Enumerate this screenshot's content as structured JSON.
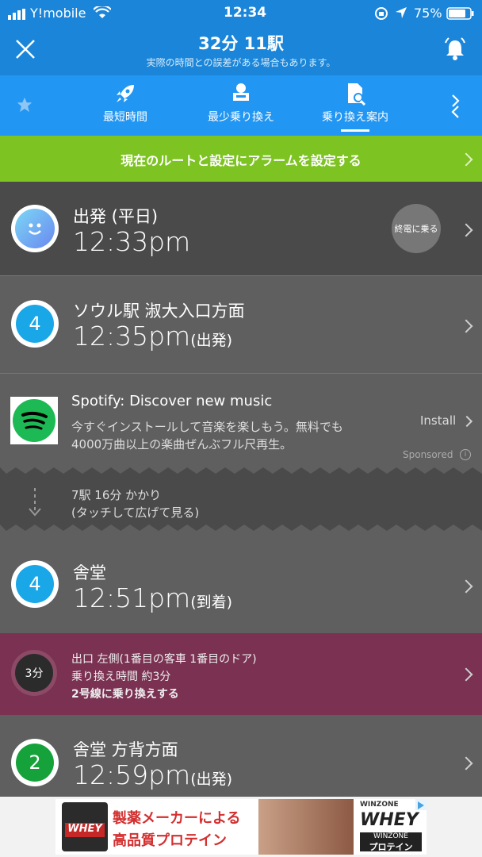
{
  "status_bar": {
    "carrier": "Y!mobile",
    "time": "12:34",
    "battery": "75%"
  },
  "header": {
    "title": "32分 11駅",
    "subtitle": "実際の時間との誤差がある場合もあります。"
  },
  "tabs": [
    {
      "label": "最短時間",
      "icon": "rocket-icon"
    },
    {
      "label": "最少乗り換え",
      "icon": "seat-icon"
    },
    {
      "label": "乗り換え案内",
      "icon": "document-search-icon",
      "active": true
    }
  ],
  "alarm_banner": {
    "label": "現在のルートと設定にアラームを設定する"
  },
  "departure": {
    "label": "出発 (平日)",
    "time": "12:33pm",
    "badge": "終電に乗る"
  },
  "station1": {
    "line_number": "4",
    "name": "ソウル駅 淑大入口方面",
    "time": "12:35pm",
    "suffix": "(出発)",
    "line_color": "#1aa7e8"
  },
  "ad1": {
    "title": "Spotify: Discover new music",
    "desc_line1": "今すぐインストールして音楽を楽しもう。無料でも",
    "desc_line2": "4000万曲以上の楽曲ぜんぶフル尺再生。",
    "install": "Install",
    "sponsored": "Sponsored"
  },
  "ride_info": {
    "line1": "7駅 16分 かかり",
    "line2": "(タッチして広げて見る)"
  },
  "station2": {
    "line_number": "4",
    "name": "舎堂",
    "time": "12:51pm",
    "suffix": "(到着)",
    "line_color": "#1aa7e8"
  },
  "transfer": {
    "minutes": "3分",
    "line1": "出口 左側(1番目の客車 1番目のドア)",
    "line2": "乗り換え時間 約3分",
    "line3": "2号線に乗り換えする",
    "color": "#7a3152"
  },
  "station3": {
    "line_number": "2",
    "name": "舎堂 方背方面",
    "time": "12:59pm",
    "suffix": "(出発)",
    "line_color": "#16a23a"
  },
  "ad2": {
    "line1": "製薬メーカーによる",
    "line2": "高品質プロテイン",
    "brand": "WHEY",
    "sub_brand": "WINZONE",
    "product": "プロテイン"
  }
}
